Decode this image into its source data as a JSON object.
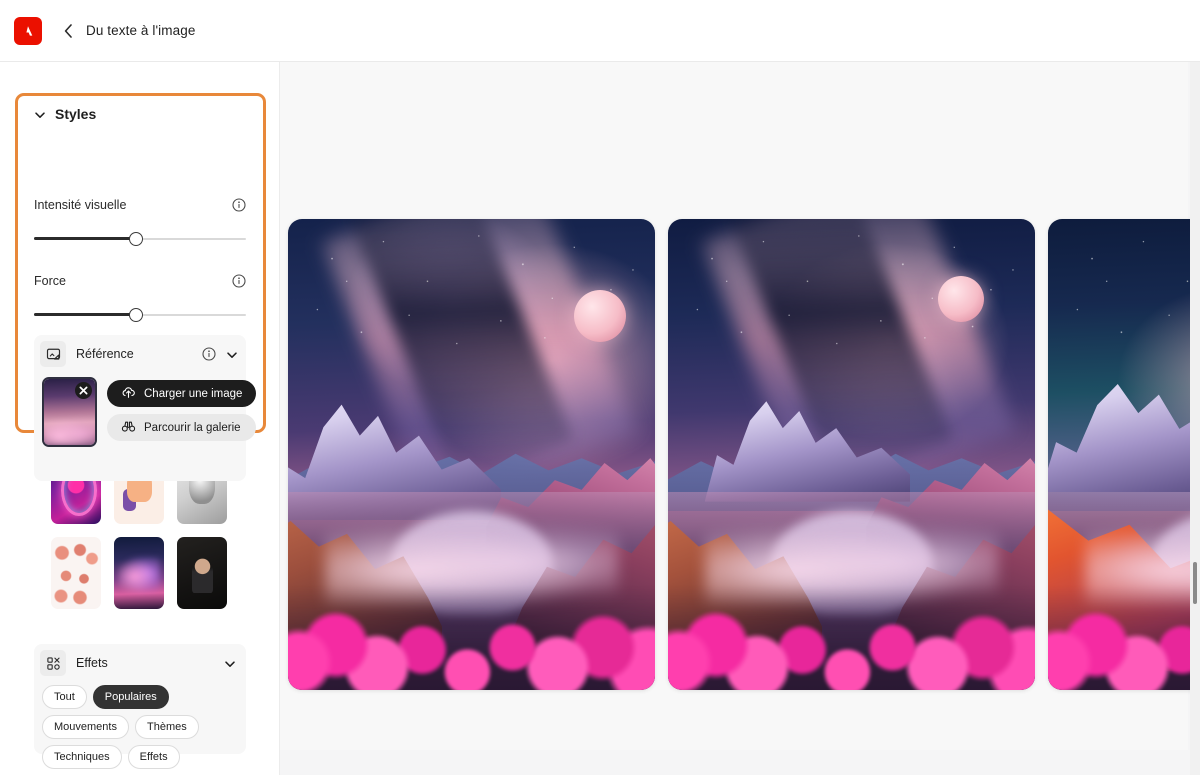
{
  "header": {
    "logo_alt": "Adobe",
    "back_label": "Retour",
    "title": "Du texte à l'image"
  },
  "sidebar": {
    "styles": {
      "title": "Styles",
      "chevron": "chevron-down-icon",
      "visual_intensity": {
        "label": "Intensité visuelle",
        "info": "info-icon",
        "value": 48,
        "min": 0,
        "max": 100
      },
      "strength": {
        "label": "Force",
        "info": "info-icon",
        "value": 48,
        "min": 0,
        "max": 100
      },
      "reference": {
        "title": "Référence",
        "icon": "image-reference-icon",
        "info": "info-icon",
        "chevron": "chevron-down-icon",
        "thumbnail_alt": "Image de référence",
        "remove_label": "×",
        "upload_label": "Charger une image",
        "upload_icon": "upload-cloud-icon",
        "browse_label": "Parcourir la galerie",
        "browse_icon": "binoculars-icon"
      }
    },
    "style_thumbnails": [
      {
        "name": "neon-silhouette",
        "alt": "Silhouette néon"
      },
      {
        "name": "thumbs-up-illustration",
        "alt": "Illustration pouce levé"
      },
      {
        "name": "classical-statue",
        "alt": "Statue classique"
      },
      {
        "name": "figure-studies",
        "alt": "Études de personnages"
      },
      {
        "name": "pink-cloud",
        "alt": "Nuage rose"
      },
      {
        "name": "dark-portrait",
        "alt": "Portrait sombre"
      }
    ],
    "effects": {
      "title": "Effets",
      "icon": "effects-grid-icon",
      "chevron": "chevron-down-icon",
      "chips": [
        {
          "label": "Tout",
          "active": false
        },
        {
          "label": "Populaires",
          "active": true
        },
        {
          "label": "Mouvements",
          "active": false
        },
        {
          "label": "Thèmes",
          "active": false
        },
        {
          "label": "Techniques",
          "active": false
        },
        {
          "label": "Effets",
          "active": false
        }
      ]
    }
  },
  "canvas": {
    "results": [
      {
        "alt": "Paysage montagneux avec ciel galactique, variante 1"
      },
      {
        "alt": "Paysage montagneux avec rivière et fleurs roses, variante 2"
      },
      {
        "alt": "Paysage montagneux rose et orange, variante 3"
      }
    ]
  },
  "colors": {
    "highlight": "#E8883A",
    "accent_dark": "#1d1d1d",
    "adobe_red": "#EB1000",
    "canvas_bg": "#f8f8f8"
  }
}
